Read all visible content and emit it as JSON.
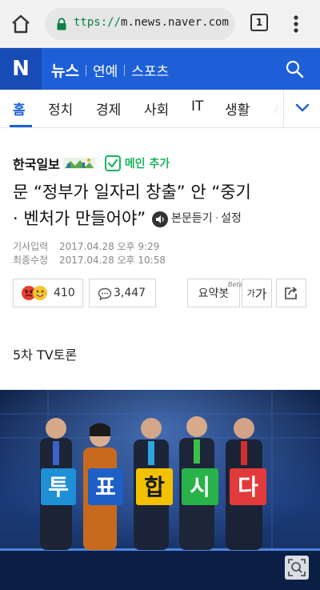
{
  "browser": {
    "url_scheme": "ttps://",
    "url_host": "m.news.naver.com",
    "tab_count": "1",
    "icons": [
      "home-icon",
      "lock-icon",
      "tab-switcher-icon",
      "overflow-menu-icon"
    ]
  },
  "header": {
    "logo": "N",
    "section": "뉴스",
    "links": [
      "연예",
      "스포츠"
    ],
    "brand_color": "#1e5fd7"
  },
  "categories": {
    "tabs": [
      "홈",
      "정치",
      "경제",
      "사회",
      "IT",
      "생활"
    ],
    "partial_tab": "세",
    "active": "홈"
  },
  "article": {
    "press": "한국일보",
    "main_add": "메인 추가",
    "headline_line1": "문 “정부가 일자리 창출” 안 “중기",
    "headline_line2": "· 벤처가 만들어야”",
    "listen": "본문듣기",
    "settings": "설정",
    "published_label": "기사입력",
    "published": "2017.04.28 오후 9:29",
    "modified_label": "최종수정",
    "modified": "2017.04.28 오후 10:58",
    "reaction_count": "410",
    "comment_count": "3,447",
    "summary": "요약봇",
    "summary_beta": "Beta",
    "font_small": "가",
    "font_big": "가",
    "body_first_line": "5차 TV토론"
  },
  "photo": {
    "cards": [
      "투",
      "표",
      "합",
      "시",
      "다"
    ],
    "card_colors": [
      "#1f8fd6",
      "#1e5fc8",
      "#f2c200",
      "#2ab24a",
      "#e23a3a"
    ]
  }
}
